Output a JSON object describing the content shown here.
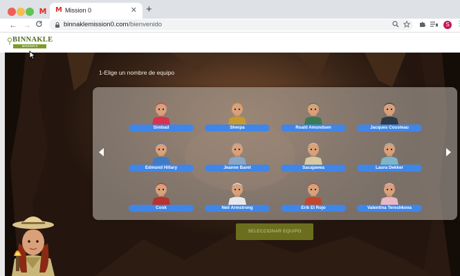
{
  "browser": {
    "pinned_tab_glyph": "M",
    "tab": {
      "favicon": "M",
      "title": "Mission 0",
      "close": "✕"
    },
    "new_tab": "+",
    "nav": {
      "back": "←",
      "forward": "→",
      "reload": "C"
    },
    "url": {
      "host": "binnaklemission0.com",
      "path": "/bienvenido"
    },
    "profile_initial": "S",
    "menu": "⋮"
  },
  "site": {
    "logo_text": "BINNAKLE",
    "logo_sub": "MISSION 0"
  },
  "game": {
    "instruction": "1-Elige un nombre de equipo",
    "select_button": "SELECCIONAR EQUIPO",
    "teams": [
      {
        "name": "Simbad",
        "icon": "turban-avatar-icon",
        "color": "#d9324f"
      },
      {
        "name": "Sherpa",
        "icon": "sherpa-avatar-icon",
        "color": "#c99a2e"
      },
      {
        "name": "Roald Amundsen",
        "icon": "explorer-goggles-avatar-icon",
        "color": "#3c7a55"
      },
      {
        "name": "Jacques Cousteau",
        "icon": "diver-avatar-icon",
        "color": "#2f3b47"
      },
      {
        "name": "Edmund Hillary",
        "icon": "climber-avatar-icon",
        "color": "#3f7cc4"
      },
      {
        "name": "Jeanne Baret",
        "icon": "sailor-avatar-icon",
        "color": "#8aa7c4"
      },
      {
        "name": "Sacajawea",
        "icon": "native-avatar-icon",
        "color": "#d9c9a0"
      },
      {
        "name": "Laura Dekker",
        "icon": "sailor-girl-avatar-icon",
        "color": "#7fb5c9"
      },
      {
        "name": "Cook",
        "icon": "pirate-avatar-icon",
        "color": "#b8322e"
      },
      {
        "name": "Neil Armstrong",
        "icon": "astronaut-avatar-icon",
        "color": "#e8e8ec"
      },
      {
        "name": "Erik El Rojo",
        "icon": "viking-avatar-icon",
        "color": "#c4472c"
      },
      {
        "name": "Valentina Tereshkova",
        "icon": "cosmonaut-avatar-icon",
        "color": "#e8b8c4"
      }
    ]
  },
  "colors": {
    "label_blue": "#3f86e8",
    "button_olive": "#6b6f1d",
    "logo_green": "#4d6b1f"
  }
}
